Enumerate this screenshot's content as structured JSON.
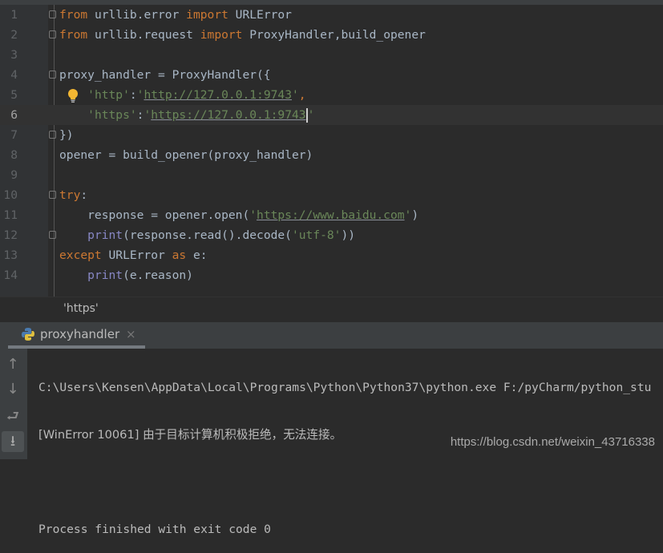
{
  "editor": {
    "current_line": 6,
    "lines": [
      {
        "n": "1",
        "fold": true,
        "tokens": [
          [
            "kw",
            "from"
          ],
          [
            "pl",
            " urllib.error "
          ],
          [
            "kw",
            "import"
          ],
          [
            "pl",
            " URLError"
          ]
        ]
      },
      {
        "n": "2",
        "fold": true,
        "tokens": [
          [
            "kw",
            "from"
          ],
          [
            "pl",
            " urllib.request "
          ],
          [
            "kw",
            "import"
          ],
          [
            "pl",
            " ProxyHandler,build_opener"
          ]
        ]
      },
      {
        "n": "3",
        "tokens": []
      },
      {
        "n": "4",
        "fold": true,
        "tokens": [
          [
            "pl",
            "proxy_handler = ProxyHandler({"
          ]
        ]
      },
      {
        "n": "5",
        "bulb": true,
        "tokens": [
          [
            "pl",
            "    "
          ],
          [
            "str",
            "'http'"
          ],
          [
            "pl",
            ":"
          ],
          [
            "str",
            "'"
          ],
          [
            "url",
            "http://127.0.0.1:9743"
          ],
          [
            "str",
            "'"
          ],
          [
            "kw",
            ","
          ]
        ]
      },
      {
        "n": "6",
        "tokens": [
          [
            "pl",
            "    "
          ],
          [
            "str",
            "'https'"
          ],
          [
            "pl",
            ":"
          ],
          [
            "str",
            "'"
          ],
          [
            "url",
            "https://127.0.0.1:9743"
          ],
          [
            "caret",
            ""
          ],
          [
            "str",
            "'"
          ]
        ]
      },
      {
        "n": "7",
        "fold": true,
        "tokens": [
          [
            "pl",
            "})"
          ]
        ]
      },
      {
        "n": "8",
        "tokens": [
          [
            "pl",
            "opener = build_opener(proxy_handler)"
          ]
        ]
      },
      {
        "n": "9",
        "tokens": []
      },
      {
        "n": "10",
        "fold": true,
        "tokens": [
          [
            "kw",
            "try"
          ],
          [
            "pl",
            ":"
          ]
        ]
      },
      {
        "n": "11",
        "tokens": [
          [
            "pl",
            "    response = opener.open("
          ],
          [
            "str",
            "'"
          ],
          [
            "url",
            "https://www.baidu.com"
          ],
          [
            "str",
            "'"
          ],
          [
            "pl",
            ")"
          ]
        ]
      },
      {
        "n": "12",
        "fold": true,
        "tokens": [
          [
            "pl",
            "    "
          ],
          [
            "bi",
            "print"
          ],
          [
            "pl",
            "(response.read().decode("
          ],
          [
            "str",
            "'utf-8'"
          ],
          [
            "pl",
            "))"
          ]
        ]
      },
      {
        "n": "13",
        "tokens": [
          [
            "kw",
            "except"
          ],
          [
            "pl",
            " URLError "
          ],
          [
            "kw",
            "as"
          ],
          [
            "pl",
            " e:"
          ]
        ]
      },
      {
        "n": "14",
        "tokens": [
          [
            "pl",
            "    "
          ],
          [
            "bi",
            "print"
          ],
          [
            "pl",
            "(e.reason)"
          ]
        ]
      }
    ]
  },
  "breadcrumb": "'https'",
  "run": {
    "tab_label": "proxyhandler",
    "close_icon": "×",
    "tools": [
      "arrow-up-icon",
      "arrow-down-icon",
      "soft-wrap-icon",
      "scroll-to-end-icon"
    ],
    "output": [
      "C:\\Users\\Kensen\\AppData\\Local\\Programs\\Python\\Python37\\python.exe F:/pyCharm/python_stu",
      "[WinError 10061] 由于目标计算机积极拒绝，无法连接。",
      "",
      "Process finished with exit code 0"
    ]
  },
  "watermark": "https://blog.csdn.net/weixin_43716338"
}
